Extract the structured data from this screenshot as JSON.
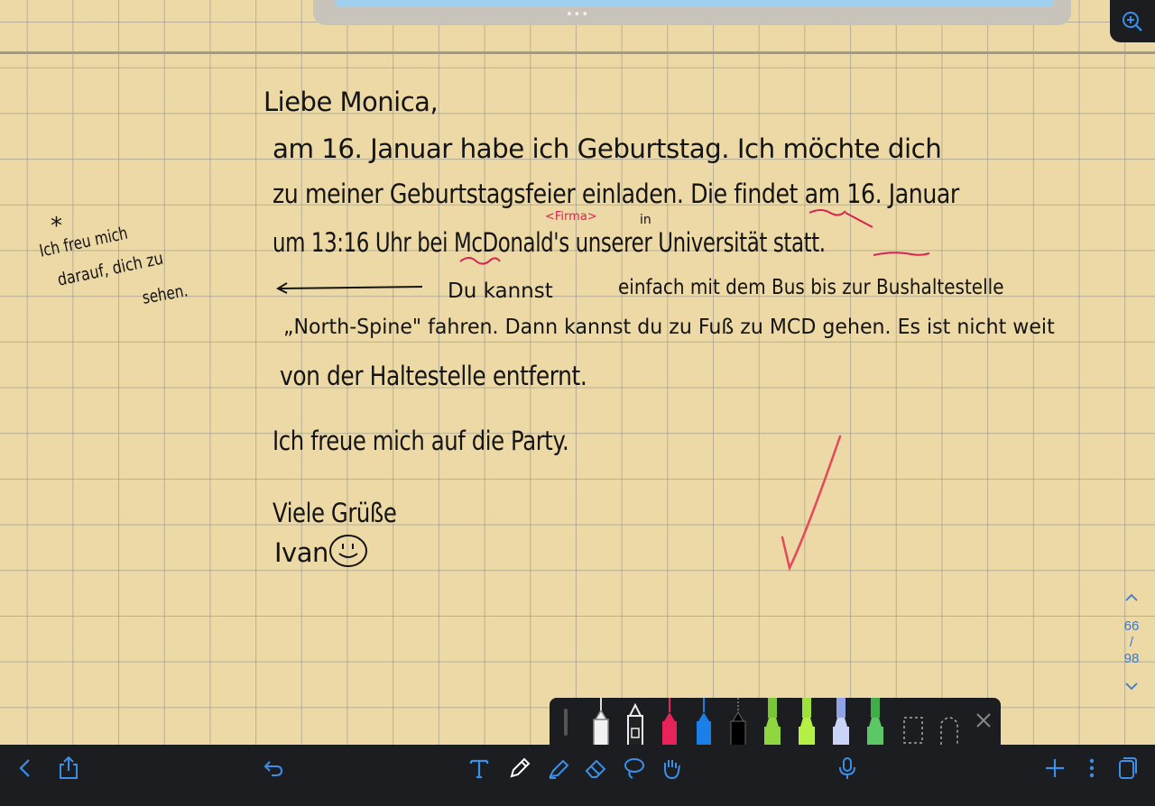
{
  "letter": {
    "greeting": "Liebe Monica,",
    "line1": "am 16. Januar habe ich Geburtstag. Ich möchte dich",
    "line2": "zu meiner Geburtstagsfeier einladen. Die findet am 16. Januar",
    "line3": "um 13:16 Uhr bei McDonald's unserer Universität statt.",
    "line4a": "Du kannst",
    "line4b": "einfach mit dem Bus bis zur Bushaltestelle",
    "line5": "„North-Spine\" fahren. Dann kannst du zu Fuß zu MCD gehen. Es ist nicht weit",
    "line6": "von der Haltestelle entfernt.",
    "line7": "Ich freue mich auf die Party.",
    "closing": "Viele Grüße",
    "signature": "Ivan"
  },
  "corrections": {
    "firma": "<Firma>",
    "insert_in": "in"
  },
  "side_note": {
    "star": "*",
    "line1": "Ich freu mich",
    "line2": "darauf, dich zu",
    "line3": "sehen."
  },
  "page_indicator": {
    "current": "66",
    "separator": "/",
    "total": "98"
  },
  "colors": {
    "paper": "#ecd9a5",
    "ink": "#141414",
    "correction": "#d7244f",
    "checkmark": "#e8465a",
    "toolbar": "#1c1d20",
    "accent_blue": "#3b7bc9"
  },
  "toolbar_icons": [
    "back-icon",
    "share-icon",
    "undo-icon",
    "text-tool-icon",
    "pen-tool-icon",
    "highlighter-icon",
    "eraser-icon",
    "lasso-icon",
    "hand-tool-icon",
    "microphone-icon",
    "add-page-icon",
    "more-icon",
    "pages-icon"
  ]
}
